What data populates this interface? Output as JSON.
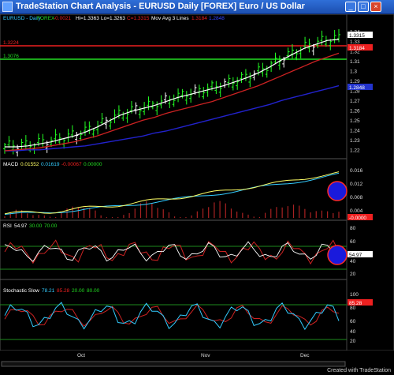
{
  "window": {
    "title": "TradeStation Chart Analysis - EURUSD  Daily  [FOREX] Euro / US Dollar",
    "controls": {
      "minimize": "_",
      "maximize": "□",
      "close": "×"
    }
  },
  "price_panel": {
    "symbol": "EURUSD - Daily",
    "exchange": "FOREX",
    "change": "-0.0021",
    "high": "Hi=1.3363",
    "low": "Lo=1.3263",
    "close": "C=1.3315",
    "study": "Mov Avg 3 Lines",
    "ma_values": [
      "1.3184",
      "1.2848"
    ],
    "hline_red": "1.3224",
    "hline_green": "1.3076",
    "last_price_tag": "1.3315",
    "red_price_tag": "1.3184",
    "blue_price_tag": "1.2848",
    "axis_ticks": [
      "1.34",
      "1.33",
      "1.32",
      "1.31",
      "1.3",
      "1.29",
      "1.28",
      "1.27",
      "1.26",
      "1.25",
      "1.24",
      "1.23",
      "1.22"
    ]
  },
  "macd_panel": {
    "label": "MACD",
    "values": [
      "0.01552",
      "0.01619",
      "-0.00067",
      "0.00000"
    ],
    "axis_ticks": [
      "0.016",
      "0.012",
      "0.008",
      "0.004"
    ],
    "last_tag": "-0.0000"
  },
  "rsi_panel": {
    "label": "RSI",
    "values": [
      "54.97",
      "30.00",
      "70.00"
    ],
    "axis_ticks": [
      "80",
      "60",
      "40",
      "20"
    ],
    "last_tag": "54.97"
  },
  "stoch_panel": {
    "label": "Stochastic Slow",
    "values": [
      "78.21",
      "85.28",
      "20.00",
      "80.00"
    ],
    "axis_ticks": [
      "100",
      "80",
      "60",
      "40",
      "20"
    ],
    "last_tag": "85.28"
  },
  "x_axis": {
    "labels": [
      "Oct",
      "Nov",
      "Dec"
    ]
  },
  "footer": {
    "credit": "Created with TradeStation"
  },
  "colors": {
    "price_bar": "#22ff22",
    "price_bar_alt": "#ffffff",
    "ma_fast": "#ffffff",
    "ma_mid": "#cc2222",
    "ma_slow": "#2222cc",
    "hline_red": "#ee2020",
    "hline_green": "#22dd22",
    "macd": "#ffff66",
    "macd_signal": "#33ccff",
    "macd_hist": "#aa2222",
    "rsi": "#cc2222",
    "stoch_k": "#33ccff",
    "stoch_d": "#cc2222",
    "guide": "#1e8a1e",
    "highlight_circle_fill": "#1a1adc",
    "highlight_circle_stroke": "#ff2a2a"
  },
  "chart_data": {
    "type": "line",
    "price": {
      "ma_fast": [
        1.223,
        1.223,
        1.224,
        1.226,
        1.228,
        1.231,
        1.234,
        1.238,
        1.243,
        1.249,
        1.255,
        1.259,
        1.262,
        1.265,
        1.269,
        1.273,
        1.276,
        1.279,
        1.282,
        1.285,
        1.289,
        1.293,
        1.298,
        1.304,
        1.311,
        1.317,
        1.323,
        1.327,
        1.331,
        1.332
      ],
      "ma_mid": [
        1.219,
        1.22,
        1.221,
        1.222,
        1.224,
        1.226,
        1.228,
        1.231,
        1.234,
        1.238,
        1.242,
        1.246,
        1.25,
        1.253,
        1.257,
        1.26,
        1.263,
        1.266,
        1.269,
        1.273,
        1.277,
        1.281,
        1.285,
        1.29,
        1.295,
        1.3,
        1.305,
        1.31,
        1.314,
        1.318
      ],
      "ma_slow": [
        1.219,
        1.219,
        1.22,
        1.22,
        1.221,
        1.222,
        1.223,
        1.224,
        1.226,
        1.228,
        1.23,
        1.232,
        1.234,
        1.237,
        1.239,
        1.242,
        1.245,
        1.248,
        1.251,
        1.254,
        1.257,
        1.26,
        1.263,
        1.266,
        1.27,
        1.273,
        1.276,
        1.279,
        1.282,
        1.285
      ],
      "ylim": [
        1.215,
        1.348
      ]
    }
  }
}
